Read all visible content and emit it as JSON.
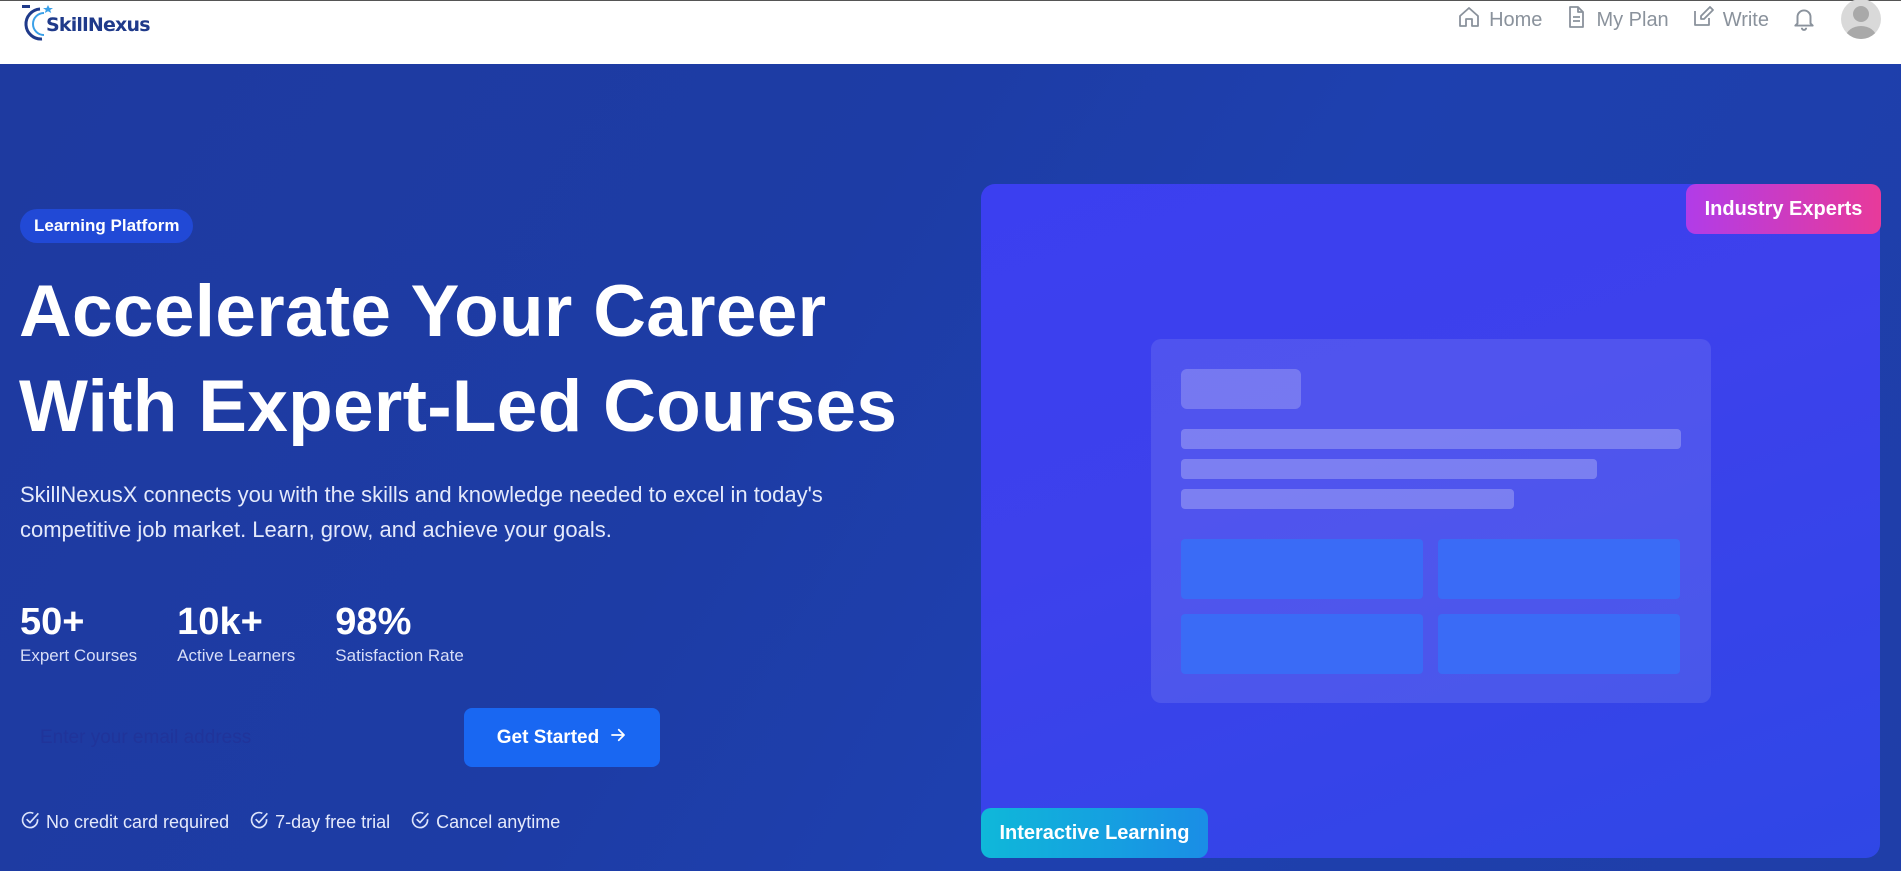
{
  "nav": {
    "logo_text": "SkillNexus",
    "links": [
      {
        "label": "Home",
        "icon": "home-icon"
      },
      {
        "label": "My Plan",
        "icon": "document-icon"
      },
      {
        "label": "Write",
        "icon": "edit-icon"
      }
    ],
    "bell_icon": "bell-icon",
    "avatar_icon": "user-avatar-icon"
  },
  "hero": {
    "badge": "Learning Platform",
    "headline_line1": "Accelerate Your Career",
    "headline_line2": "With Expert-Led Courses",
    "subtext_line1": "SkillNexusX connects you with the skills and knowledge needed to excel in today's",
    "subtext_line2": "competitive job market. Learn, grow, and achieve your goals.",
    "stats": [
      {
        "value": "50+",
        "label": "Expert Courses"
      },
      {
        "value": "10k+",
        "label": "Active Learners"
      },
      {
        "value": "98%",
        "label": "Satisfaction Rate"
      }
    ],
    "email_placeholder": "Enter your email address",
    "cta_label": "Get Started",
    "checks": [
      "No credit card required",
      "7-day free trial",
      "Cancel anytime"
    ]
  },
  "visual": {
    "tag_top": "Industry Experts",
    "tag_bottom": "Interactive Learning"
  },
  "colors": {
    "hero_bg": "#1e3aa0",
    "cta": "#1967f2",
    "badge": "#2149d6",
    "card": "#3b3ff0"
  }
}
